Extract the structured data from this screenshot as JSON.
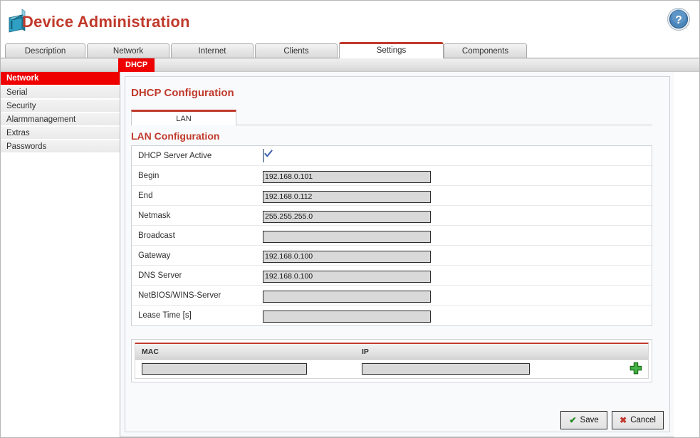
{
  "header": {
    "title": "Device Administration",
    "logo_icon": "device-icon",
    "help_icon": "help-question-icon"
  },
  "main_tabs": [
    {
      "label": "Description",
      "active": false
    },
    {
      "label": "Network",
      "active": false
    },
    {
      "label": "Internet",
      "active": false
    },
    {
      "label": "Clients",
      "active": false
    },
    {
      "label": "Settings",
      "active": true
    },
    {
      "label": "Components",
      "active": false
    }
  ],
  "sub_tabs": [
    {
      "label": "DHCP",
      "active": true
    }
  ],
  "sidebar": {
    "items": [
      {
        "label": "Network",
        "active": true
      },
      {
        "label": "Serial",
        "active": false
      },
      {
        "label": "Security",
        "active": false
      },
      {
        "label": "Alarmmanagement",
        "active": false
      },
      {
        "label": "Extras",
        "active": false
      },
      {
        "label": "Passwords",
        "active": false
      }
    ]
  },
  "content": {
    "page_title": "DHCP Configuration",
    "inner_tabs": [
      {
        "label": "LAN",
        "active": true
      }
    ],
    "section_title": "LAN Configuration",
    "fields": [
      {
        "label": "DHCP Server Active",
        "type": "checkbox",
        "checked": true,
        "value": ""
      },
      {
        "label": "Begin",
        "type": "text",
        "value": "192.168.0.101",
        "placeholder": ""
      },
      {
        "label": "End",
        "type": "text",
        "value": "192.168.0.112",
        "placeholder": ""
      },
      {
        "label": "Netmask",
        "type": "text",
        "value": "255.255.255.0",
        "placeholder": ""
      },
      {
        "label": "Broadcast",
        "type": "text",
        "value": "",
        "placeholder": ""
      },
      {
        "label": "Gateway",
        "type": "text",
        "value": "192.168.0.100",
        "placeholder": ""
      },
      {
        "label": "DNS Server",
        "type": "text",
        "value": "192.168.0.100",
        "placeholder": ""
      },
      {
        "label": "NetBIOS/WINS-Server",
        "type": "text",
        "value": "",
        "placeholder": ""
      },
      {
        "label": "Lease Time [s]",
        "type": "text",
        "value": "",
        "placeholder": ""
      }
    ],
    "reservation_table": {
      "columns": [
        "MAC",
        "IP"
      ],
      "rows": [
        {
          "mac": "",
          "ip": ""
        }
      ],
      "add_icon": "add-plus-icon"
    }
  },
  "footer": {
    "save_label": "Save",
    "cancel_label": "Cancel",
    "save_icon": "checkmark-icon",
    "cancel_icon": "cross-icon"
  },
  "colors": {
    "accent_red": "#c0392b",
    "active_red": "#ee0000",
    "field_gray": "#d9d9d9",
    "ok_green": "#1a8a1a",
    "help_blue": "#3a7bbf"
  }
}
